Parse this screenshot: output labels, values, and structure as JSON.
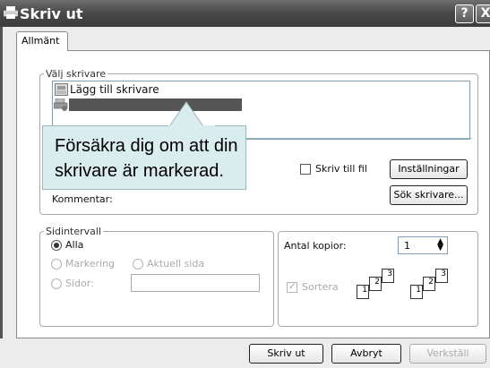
{
  "window": {
    "title": "Skriv ut",
    "help_glyph": "?",
    "close_glyph": "X"
  },
  "tabs": [
    {
      "label": "Allmänt"
    }
  ],
  "printer_group": {
    "legend": "Välj skrivare",
    "items": [
      {
        "label": "Lägg till skrivare",
        "icon": "add-printer-icon"
      },
      {
        "label": "",
        "icon": "printer-icon",
        "selected": true
      }
    ],
    "print_to_file_label": "Skriv till fil",
    "print_to_file_checked": false,
    "preferences_button": "Inställningar",
    "find_printer_button": "Sök skrivare...",
    "comment_label": "Kommentar:"
  },
  "tooltip": {
    "text": "Försäkra dig om att din skrivare är markerad."
  },
  "page_range": {
    "legend": "Sidintervall",
    "all_label": "Alla",
    "selection_label": "Markering",
    "current_page_label": "Aktuell sida",
    "pages_label": "Sidor:",
    "pages_value": "",
    "selected": "all"
  },
  "copies": {
    "label": "Antal kopior:",
    "value": "1",
    "collate_label": "Sortera",
    "collate_checked": true
  },
  "buttons": {
    "print": "Skriv ut",
    "cancel": "Avbryt",
    "apply": "Verkställ"
  },
  "colors": {
    "titlebar": "#4a4a4a",
    "tooltip_bg": "#d9ecee",
    "selection": "#555555"
  }
}
